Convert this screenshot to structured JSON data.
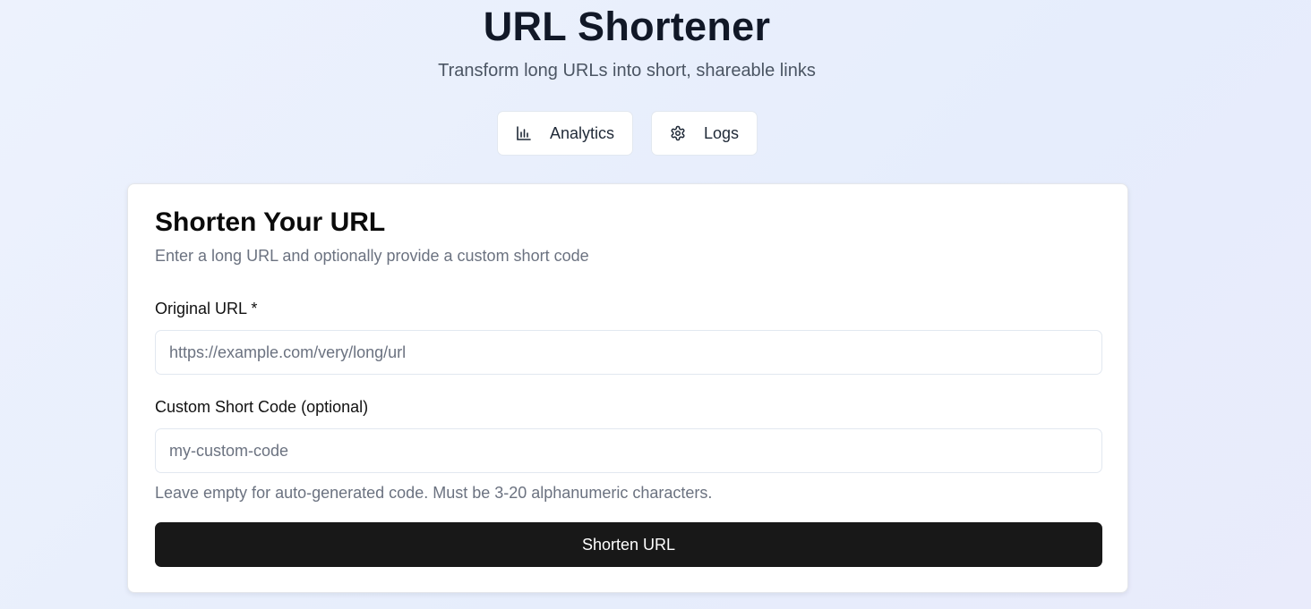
{
  "header": {
    "title": "URL Shortener",
    "subtitle": "Transform long URLs into short, shareable links"
  },
  "nav": {
    "analytics": {
      "label": "Analytics",
      "icon": "bar-chart-icon"
    },
    "logs": {
      "label": "Logs",
      "icon": "gear-icon"
    }
  },
  "form": {
    "title": "Shorten Your URL",
    "description": "Enter a long URL and optionally provide a custom short code",
    "url_label": "Original URL *",
    "url_placeholder": "https://example.com/very/long/url",
    "url_value": "",
    "code_label": "Custom Short Code (optional)",
    "code_placeholder": "my-custom-code",
    "code_value": "",
    "hint": "Leave empty for auto-generated code. Must be 3-20 alphanumeric characters.",
    "submit_label": "Shorten URL"
  },
  "colors": {
    "primary_button": "#181818",
    "background": "#e9effc"
  }
}
